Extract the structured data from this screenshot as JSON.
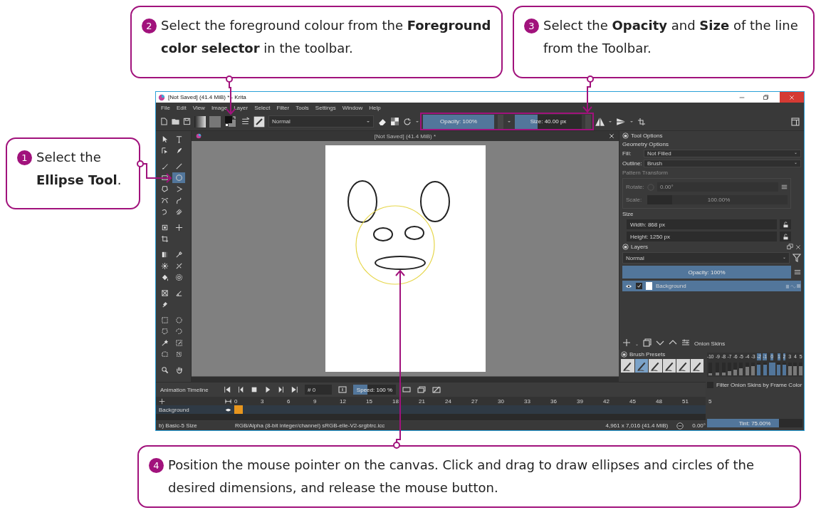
{
  "callouts": [
    {
      "number": "1",
      "text": "Select the **Ellipse Tool**."
    },
    {
      "number": "2",
      "text": "Select the foreground colour from the **Foreground color selector** in the toolbar."
    },
    {
      "number": "3",
      "text": "Select the **Opacity** and **Size** of the line from the Toolbar."
    },
    {
      "number": "4",
      "text": "Position the mouse pointer on the canvas. Click and drag to draw ellipses and circles of the desired dimensions, and release the mouse button."
    }
  ],
  "window": {
    "title": "[Not Saved]  (41.4 MiB) * - Krita"
  },
  "menu": [
    "File",
    "Edit",
    "View",
    "Image",
    "Layer",
    "Select",
    "Filter",
    "Tools",
    "Settings",
    "Window",
    "Help"
  ],
  "toolbar": {
    "blend_mode": "Normal",
    "opacity": {
      "label": "Opacity: 100%",
      "level": 1
    },
    "size": {
      "label": "Size: 40.00 px",
      "level": 0.34
    }
  },
  "tools": [
    {
      "selected": false
    },
    {
      "selected": false
    },
    {
      "selected": false
    },
    {
      "selected": false
    },
    {
      "selected": false
    },
    {
      "selected": false
    },
    {
      "selected": false
    },
    {
      "selected": true
    },
    {
      "selected": false
    },
    {
      "selected": false
    },
    {
      "selected": false
    },
    {
      "selected": false
    },
    {
      "selected": false
    },
    {
      "selected": false
    },
    {
      "selected": false
    },
    {
      "selected": false
    },
    {
      "selected": false
    },
    {
      "selected": false
    },
    {
      "selected": false
    },
    {
      "selected": false
    },
    {
      "selected": false
    },
    {
      "selected": false
    },
    {
      "selected": false
    },
    {
      "selected": false
    },
    {
      "selected": false
    },
    {
      "selected": false
    },
    {
      "selected": false
    },
    {
      "selected": false
    },
    {
      "selected": false
    },
    {
      "selected": false
    },
    {
      "selected": false
    },
    {
      "selected": false
    },
    {
      "selected": false
    },
    {
      "selected": false
    },
    {
      "selected": false
    },
    {
      "selected": false
    }
  ],
  "document_tab": {
    "title": "[Not Saved]  (41.4 MiB) *"
  },
  "tool_options": {
    "title": "Tool Options",
    "section": "Geometry Options",
    "fields": [
      {
        "label": "Fill:",
        "value": "Not Filled"
      },
      {
        "label": "Outline:",
        "value": "Brush"
      }
    ],
    "pattern_transform": {
      "title": "Pattern Transform",
      "disabled": true,
      "rotate_label": "Rotate:",
      "rotate_value": "0.00°",
      "scale_label": "Scale:",
      "scale": {
        "value": "100.00%",
        "level": 0.18
      }
    },
    "size_title": "Size",
    "width": "Width: 868 px",
    "height": "Height: 1250 px"
  },
  "layers": {
    "title": "Layers",
    "blend_mode": "Normal",
    "opacity": {
      "label": "Opacity:  100%",
      "level": 1
    },
    "items": [
      {
        "name": "Background",
        "visible": true,
        "checked": true,
        "selected": true
      }
    ],
    "buttons_label": "Onion Skins"
  },
  "brush_presets": {
    "title": "Brush Presets",
    "items": [
      {
        "selected": false
      },
      {
        "selected": true
      },
      {
        "selected": false
      },
      {
        "selected": false
      },
      {
        "selected": false
      },
      {
        "selected": false
      }
    ]
  },
  "onion_skins": {
    "frames": [
      {
        "label": "-10",
        "on": false,
        "level": 0.15
      },
      {
        "label": "-9",
        "on": false,
        "level": 0.2
      },
      {
        "label": "-8",
        "on": false,
        "level": 0.25
      },
      {
        "label": "-7",
        "on": false,
        "level": 0.35
      },
      {
        "label": "-6",
        "on": false,
        "level": 0.45
      },
      {
        "label": "-5",
        "on": false,
        "level": 0.55
      },
      {
        "label": "-4",
        "on": false,
        "level": 0.65
      },
      {
        "label": "-3",
        "on": false,
        "level": 0.75
      },
      {
        "label": "-2",
        "on": true,
        "level": 0.85
      },
      {
        "label": "-1",
        "on": true,
        "level": 0.85
      },
      {
        "label": "0",
        "on": true,
        "level": 1
      },
      {
        "label": "1",
        "on": true,
        "level": 0.85
      },
      {
        "label": "2",
        "on": true,
        "level": 0.85
      },
      {
        "label": "3",
        "on": false,
        "level": 0.75
      },
      {
        "label": "4",
        "on": false,
        "level": 0.75
      },
      {
        "label": "5",
        "on": false,
        "level": 0.75
      }
    ],
    "filter_label": "Filter Onion Skins by Frame Color",
    "filter_checked": false,
    "tint": {
      "label": "Tint: 75.00%",
      "level": 0.75
    }
  },
  "timeline": {
    "title": "Animation Timeline",
    "frame": "# 0",
    "speed": {
      "label": "Speed: 100 %",
      "level": 0.33
    },
    "ruler": [
      "0",
      "3",
      "6",
      "9",
      "12",
      "15",
      "18",
      "21",
      "24",
      "27",
      "30",
      "33",
      "36",
      "39",
      "42",
      "45",
      "48",
      "51",
      "5"
    ],
    "layer": {
      "name": "Background",
      "has_keyframe": true
    }
  },
  "status_bar": {
    "brush": "b) Basic-5 Size",
    "color_space": "RGB/Alpha (8-bit integer/channel)  sRGB-elle-V2-srgbtrc.icc",
    "image_size": "4,961 x 7,016 (41.4 MiB)",
    "rotation": "0.00°"
  }
}
